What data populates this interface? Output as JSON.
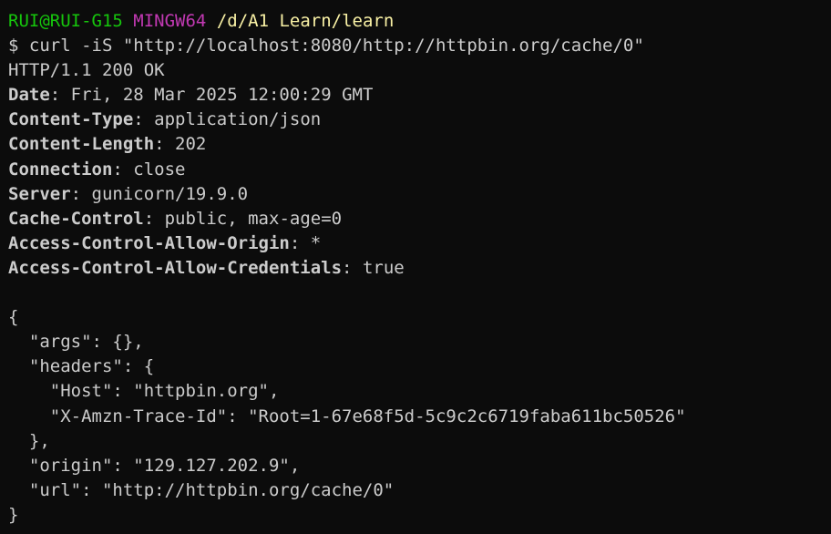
{
  "prompt": {
    "user_host": "RUI@RUI-G15",
    "system": "MINGW64",
    "path": "/d/A1 Learn/learn"
  },
  "command": "$ curl -iS \"http://localhost:8080/http://httpbin.org/cache/0\"",
  "status_line": "HTTP/1.1 200 OK",
  "headers": [
    {
      "name": "Date",
      "value": "Fri, 28 Mar 2025 12:00:29 GMT"
    },
    {
      "name": "Content-Type",
      "value": "application/json"
    },
    {
      "name": "Content-Length",
      "value": "202"
    },
    {
      "name": "Connection",
      "value": "close"
    },
    {
      "name": "Server",
      "value": "gunicorn/19.9.0"
    },
    {
      "name": "Cache-Control",
      "value": "public, max-age=0"
    },
    {
      "name": "Access-Control-Allow-Origin",
      "value": "*"
    },
    {
      "name": "Access-Control-Allow-Credentials",
      "value": "true"
    }
  ],
  "body_lines": [
    "{",
    "  \"args\": {},",
    "  \"headers\": {",
    "    \"Host\": \"httpbin.org\",",
    "    \"X-Amzn-Trace-Id\": \"Root=1-67e68f5d-5c9c2c6719faba611bc50526\"",
    "  },",
    "  \"origin\": \"129.127.202.9\",",
    "  \"url\": \"http://httpbin.org/cache/0\"",
    "}"
  ],
  "colors": {
    "background": "#0c0c0c",
    "text": "#cccccc",
    "prompt_user_host": "#16c60c",
    "prompt_system": "#c239b3",
    "prompt_path": "#f9f1a5"
  }
}
